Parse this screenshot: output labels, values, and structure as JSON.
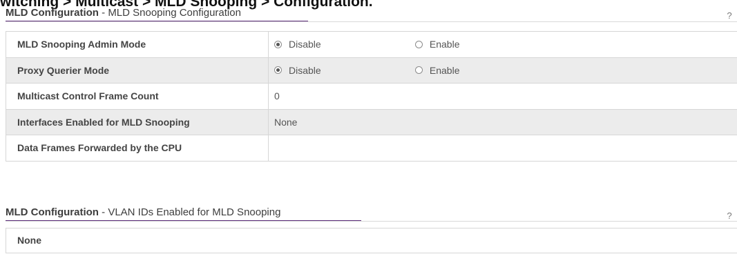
{
  "breadcrumb": "witching > Multicast > MLD Snooping > Configuration.",
  "section1": {
    "title_strong": "MLD Configuration",
    "title_rest": " - MLD Snooping Configuration",
    "help": "?"
  },
  "rows": [
    {
      "label": "MLD Snooping Admin Mode",
      "options": [
        "Disable",
        "Enable"
      ],
      "selected": "Disable"
    },
    {
      "label": "Proxy Querier Mode",
      "options": [
        "Disable",
        "Enable"
      ],
      "selected": "Disable"
    },
    {
      "label": "Multicast Control Frame Count",
      "value": "0"
    },
    {
      "label": "Interfaces Enabled for MLD Snooping",
      "value": "None"
    },
    {
      "label": "Data Frames Forwarded by the CPU",
      "value": ""
    }
  ],
  "section2": {
    "title_strong": "MLD Configuration",
    "title_rest": " - VLAN IDs Enabled for MLD Snooping",
    "help": "?",
    "value": "None"
  }
}
